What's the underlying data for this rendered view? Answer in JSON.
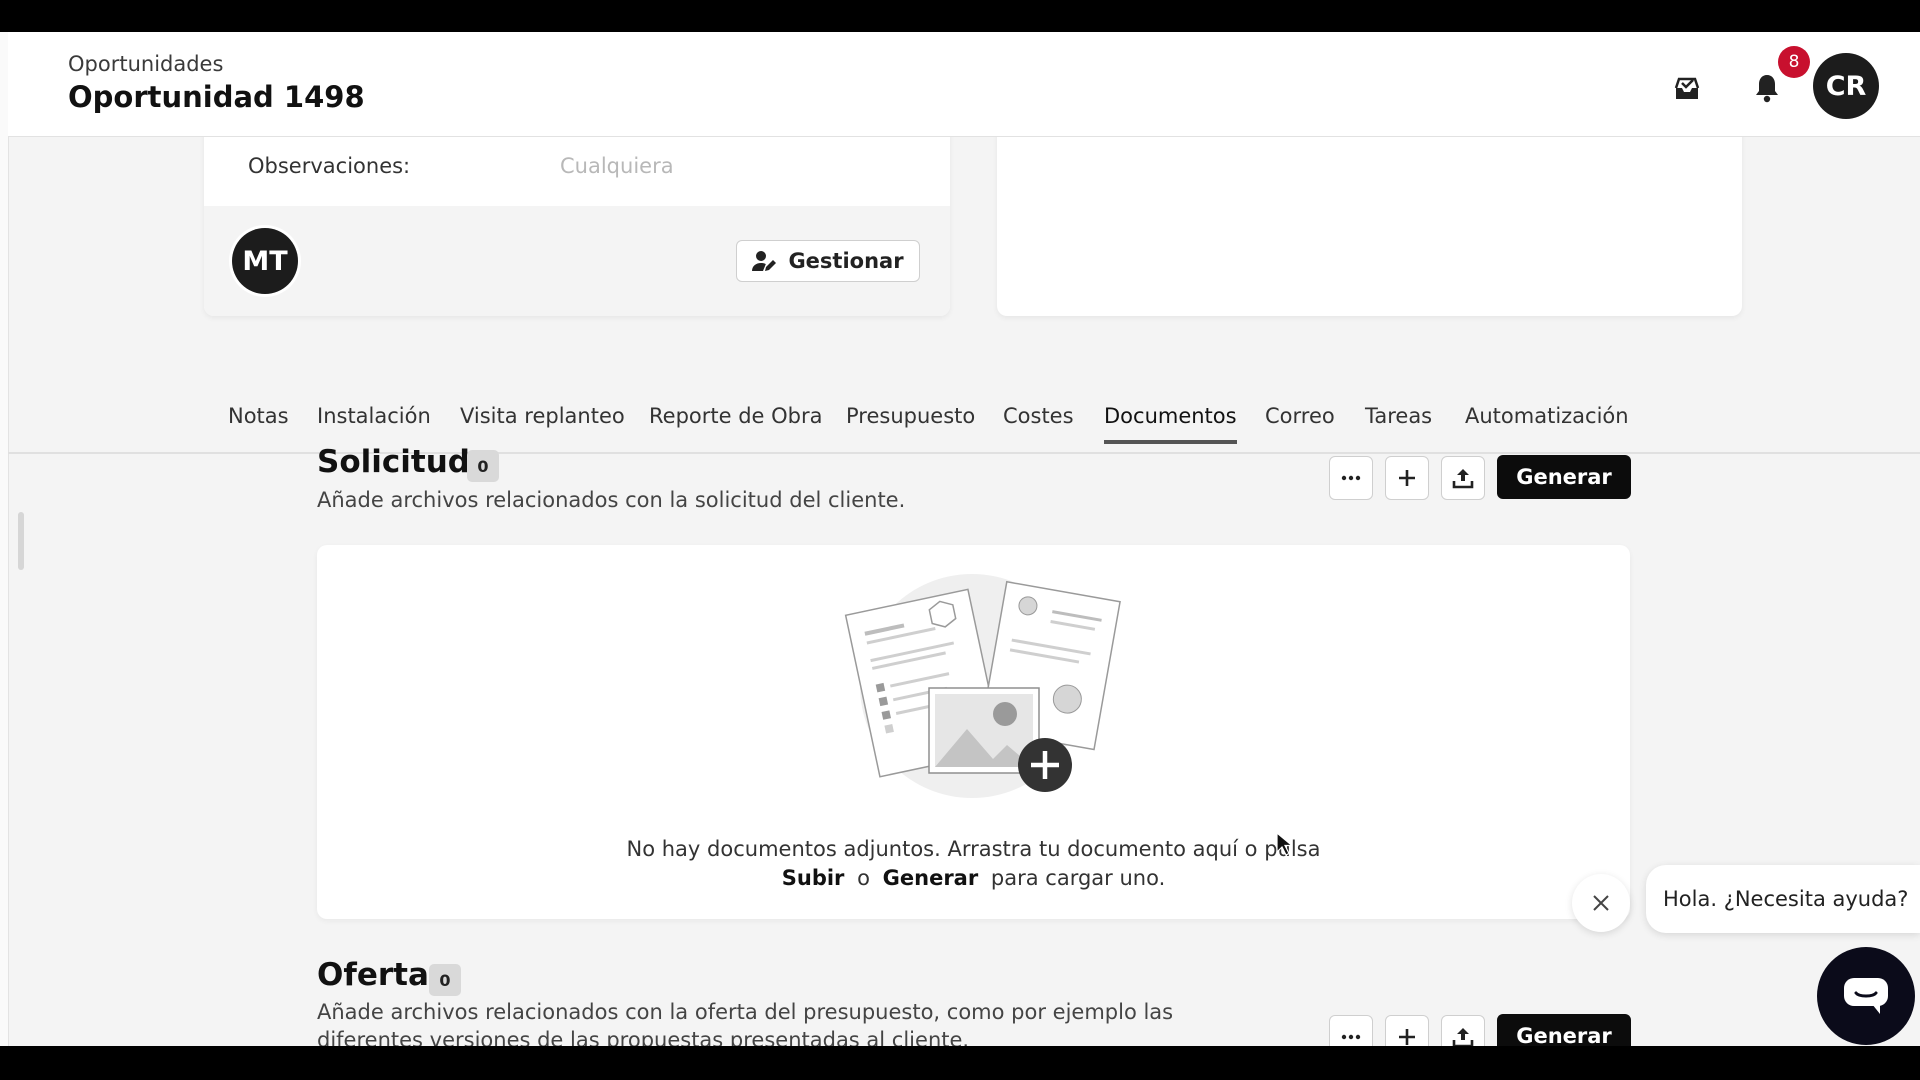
{
  "header": {
    "breadcrumb": "Oportunidades",
    "title": "Oportunidad 1498",
    "notification_count": "8",
    "user_initials": "CR"
  },
  "summary_card": {
    "obs_label": "Observaciones:",
    "obs_value": "Cualquiera",
    "assignee_initials": "MT",
    "manage_label": "Gestionar"
  },
  "tabs": [
    {
      "label": "Notas"
    },
    {
      "label": "Instalación"
    },
    {
      "label": "Visita replanteo"
    },
    {
      "label": "Reporte de Obra"
    },
    {
      "label": "Presupuesto"
    },
    {
      "label": "Costes"
    },
    {
      "label": "Documentos",
      "active": true
    },
    {
      "label": "Correo"
    },
    {
      "label": "Tareas"
    },
    {
      "label": "Automatización"
    }
  ],
  "sections": {
    "solicitud": {
      "title": "Solicitud",
      "count": "0",
      "description": "Añade archivos relacionados con la solicitud del cliente.",
      "generate_label": "Generar",
      "empty_line1": "No hay documentos adjuntos. Arrastra tu documento aquí o pulsa",
      "empty_upload": "Subir",
      "empty_or": "o",
      "empty_generate": "Generar",
      "empty_tail": "para cargar uno."
    },
    "oferta": {
      "title": "Oferta",
      "count": "0",
      "description": "Añade archivos relacionados con la oferta del presupuesto, como por ejemplo las diferentes versiones de las propuestas presentadas al cliente.",
      "generate_label": "Generar"
    }
  },
  "chat": {
    "greeting": "Hola. ¿Necesita ayuda?"
  },
  "icons": {
    "inbox": "inbox-check-icon",
    "bell": "bell-icon",
    "more": "more-horizontal-icon",
    "add": "plus-icon",
    "upload": "upload-icon",
    "close": "close-icon",
    "chat": "chat-icon",
    "manage": "user-edit-icon"
  },
  "colors": {
    "badge": "#c8102e",
    "primary_button": "#0c0c0c",
    "chat_button": "#0b0b1a"
  }
}
